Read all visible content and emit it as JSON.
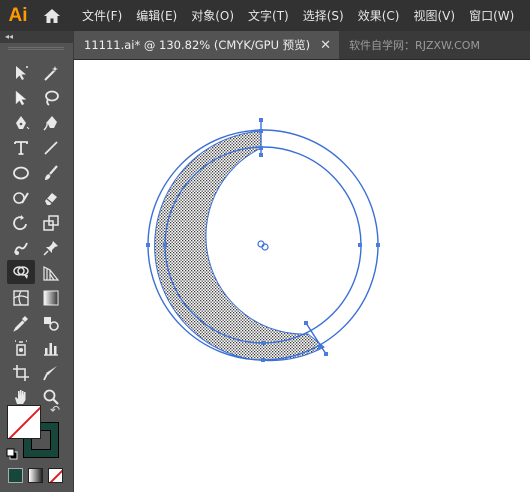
{
  "app": {
    "logo_text": "Ai",
    "brand_color": "#ff9a00"
  },
  "menu": {
    "items": [
      "文件(F)",
      "编辑(E)",
      "对象(O)",
      "文字(T)",
      "选择(S)",
      "效果(C)",
      "视图(V)",
      "窗口(W)"
    ]
  },
  "tab": {
    "title": "11111.ai* @ 130.82% (CMYK/GPU 预览)",
    "close": "✕",
    "watermark": "软件自学网：RJZXW.COM"
  },
  "panel": {
    "collapse": "◂◂"
  },
  "tools": {
    "selected": "lasso-shape-tool",
    "names": [
      "selection-tool",
      "direct-selection-tool",
      "pen-tool",
      "type-tool",
      "ellipse-tool",
      "paintbrush-tool",
      "rotate-tool",
      "puppet-warp-tool",
      "shape-builder-tool",
      "mesh-tool",
      "eyedropper-tool",
      "symbol-sprayer-tool",
      "artboard-tool",
      "hand-tool"
    ]
  },
  "colors": {
    "fill": "#ffffff",
    "stroke": "#17463a",
    "selection": "#3b6fd6"
  },
  "glyphs": {
    "swap": "↶"
  }
}
